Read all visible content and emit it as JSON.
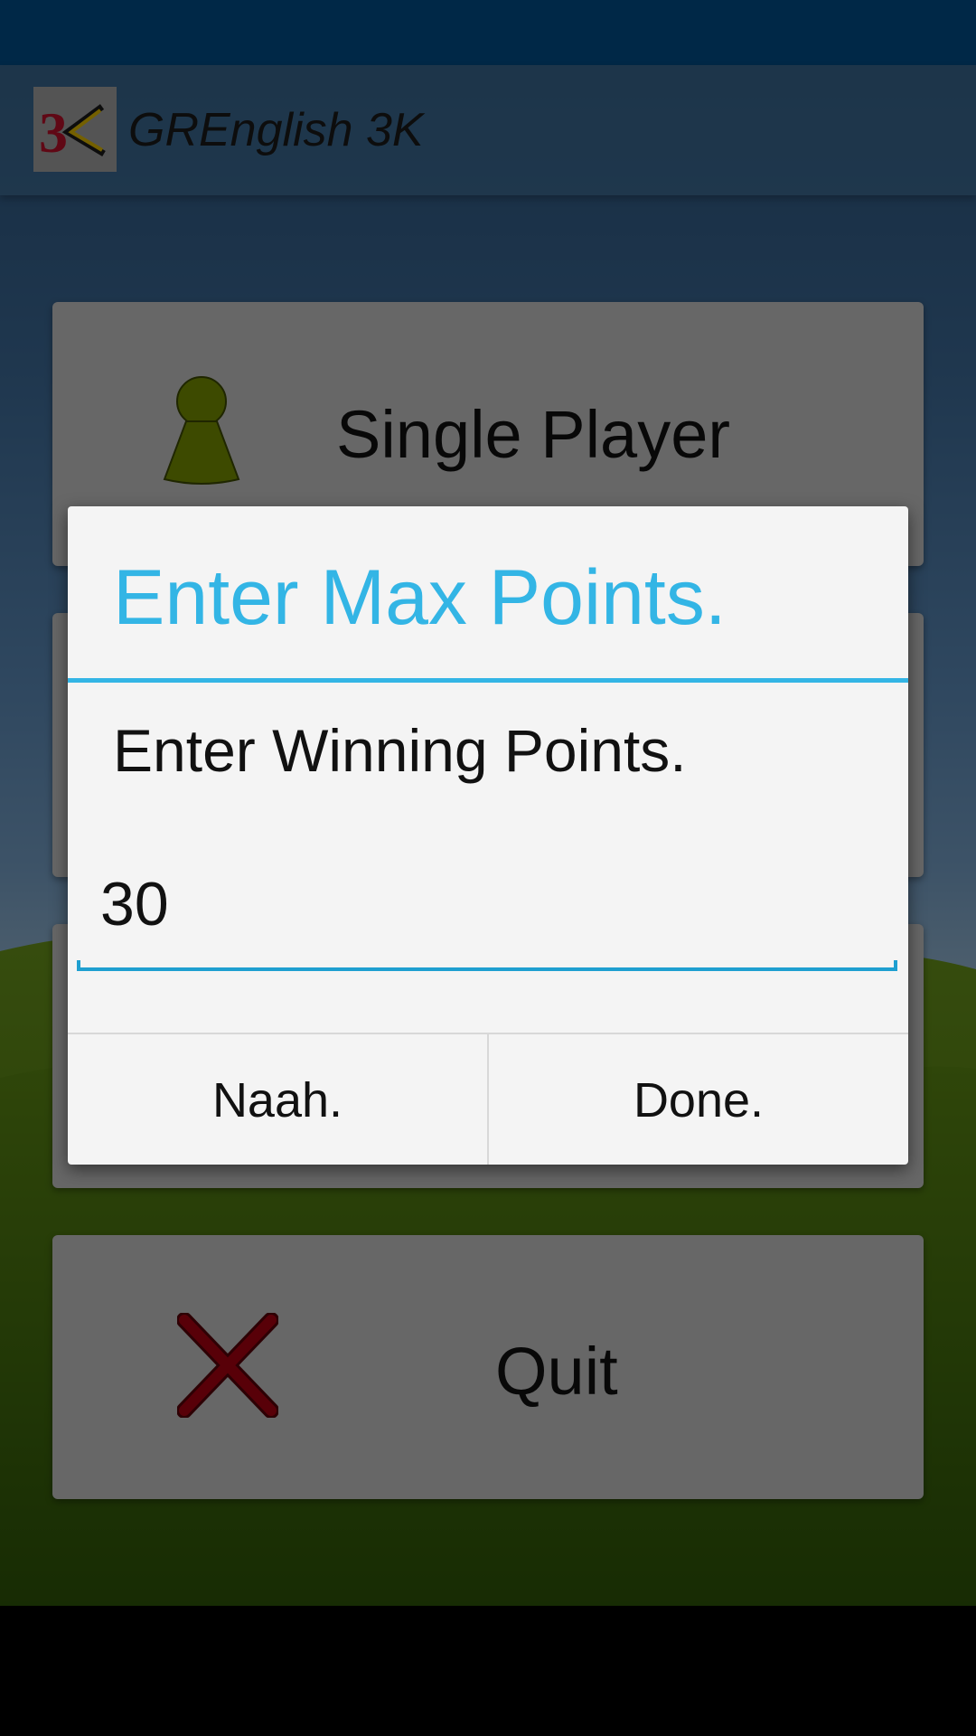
{
  "app": {
    "title": "GREnglish 3K",
    "logo_text": "3K"
  },
  "menu": {
    "single_player_label": "Single Player",
    "quit_label": "Quit"
  },
  "dialog": {
    "title": "Enter Max Points.",
    "message": "Enter Winning Points.",
    "points_value": "30",
    "cancel_label": "Naah.",
    "confirm_label": "Done."
  },
  "colors": {
    "accent": "#33b5e5",
    "status_bar": "#002847",
    "player_icon": "#7a9400",
    "quit_icon": "#b00010"
  },
  "icons": {
    "player": "player-pawn-icon",
    "quit": "red-x-icon"
  }
}
